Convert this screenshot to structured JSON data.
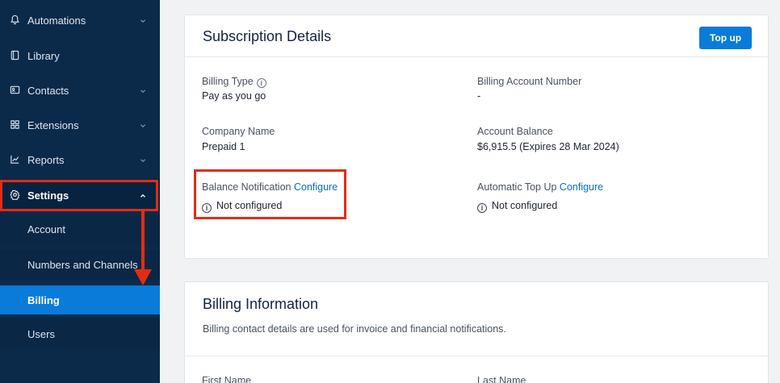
{
  "sidebar": {
    "items": [
      {
        "label": "Automations",
        "icon": "bell-icon",
        "has_chevron": true
      },
      {
        "label": "Library",
        "icon": "book-icon",
        "has_chevron": false
      },
      {
        "label": "Contacts",
        "icon": "contact-card-icon",
        "has_chevron": true
      },
      {
        "label": "Extensions",
        "icon": "grid-icon",
        "has_chevron": true
      },
      {
        "label": "Reports",
        "icon": "chart-icon",
        "has_chevron": true
      },
      {
        "label": "Settings",
        "icon": "gear-icon",
        "has_chevron": true,
        "expanded": true
      }
    ],
    "settings_children": [
      {
        "label": "Account"
      },
      {
        "label": "Numbers and Channels"
      },
      {
        "label": "Billing",
        "active": true
      },
      {
        "label": "Users"
      }
    ]
  },
  "subscription": {
    "title": "Subscription Details",
    "topup_label": "Top up",
    "billing_type_label": "Billing Type",
    "billing_type_value": "Pay as you go",
    "billing_account_number_label": "Billing Account Number",
    "billing_account_number_value": "-",
    "company_name_label": "Company Name",
    "company_name_value": "Prepaid 1",
    "account_balance_label": "Account Balance",
    "account_balance_value": "$6,915.5 (Expires 28 Mar 2024)",
    "balance_notification_label": "Balance Notification",
    "balance_notification_link": "Configure",
    "balance_notification_status": "Not configured",
    "auto_topup_label": "Automatic Top Up",
    "auto_topup_link": "Configure",
    "auto_topup_status": "Not configured"
  },
  "billing_info": {
    "title": "Billing Information",
    "subtitle": "Billing contact details are used for invoice and financial notifications.",
    "first_name_label": "First Name",
    "last_name_label": "Last Name"
  },
  "colors": {
    "sidebar_bg": "#0b2a4a",
    "active_item": "#0a7bd8",
    "annotation_red": "#e32c14",
    "link_blue": "#0a6cc4"
  }
}
